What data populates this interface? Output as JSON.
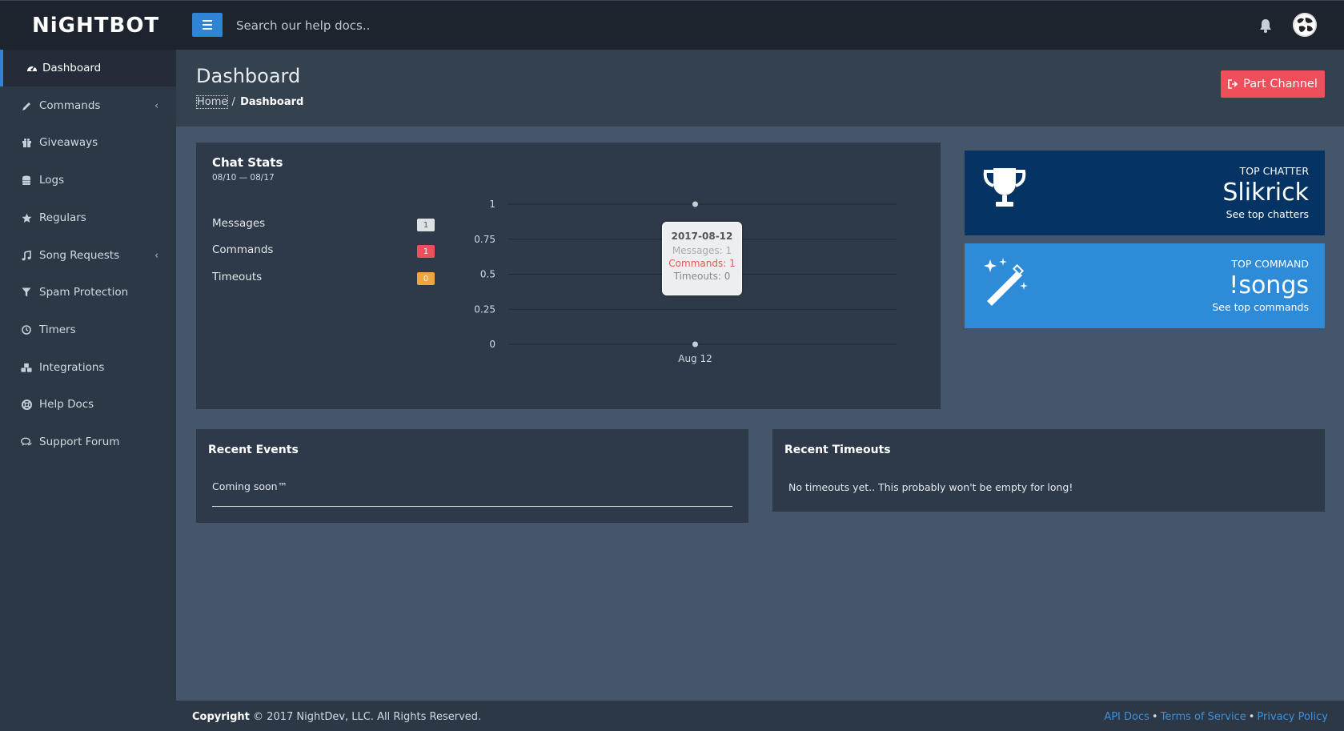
{
  "app": {
    "logo": "NiGHTBOT"
  },
  "topbar": {
    "search_placeholder": "Search our help docs.."
  },
  "sidebar": {
    "items": [
      {
        "label": "Dashboard",
        "icon": "dashboard-icon",
        "active": true
      },
      {
        "label": "Commands",
        "icon": "pencil-icon",
        "submenu": true
      },
      {
        "label": "Giveaways",
        "icon": "gift-icon"
      },
      {
        "label": "Logs",
        "icon": "database-icon"
      },
      {
        "label": "Regulars",
        "icon": "star-icon"
      },
      {
        "label": "Song Requests",
        "icon": "music-icon",
        "submenu": true
      },
      {
        "label": "Spam Protection",
        "icon": "filter-icon"
      },
      {
        "label": "Timers",
        "icon": "clock-icon"
      },
      {
        "label": "Integrations",
        "icon": "cubes-icon"
      },
      {
        "label": "Help Docs",
        "icon": "lifebuoy-icon"
      },
      {
        "label": "Support Forum",
        "icon": "comments-icon"
      }
    ]
  },
  "header": {
    "title": "Dashboard",
    "breadcrumb_home": "Home",
    "breadcrumb_sep": "/",
    "breadcrumb_current": "Dashboard",
    "part_button": "Part Channel"
  },
  "chat_stats": {
    "title": "Chat Stats",
    "range": "08/10 — 08/17",
    "rows": [
      {
        "label": "Messages",
        "value": "1",
        "color": "#dde1e5"
      },
      {
        "label": "Commands",
        "value": "1",
        "color": "#ef4f5a"
      },
      {
        "label": "Timeouts",
        "value": "0",
        "color": "#f0a43c"
      }
    ],
    "tooltip": {
      "date": "2017-08-12",
      "messages": "Messages: 1",
      "commands": "Commands: 1",
      "timeouts": "Timeouts: 0"
    }
  },
  "chart_data": {
    "type": "line",
    "x": [
      "Aug 12"
    ],
    "series": [
      {
        "name": "Messages",
        "values": [
          1
        ]
      },
      {
        "name": "Commands",
        "values": [
          1
        ]
      },
      {
        "name": "Timeouts",
        "values": [
          0
        ]
      }
    ],
    "yticks": [
      "1",
      "0.75",
      "0.5",
      "0.25",
      "0"
    ],
    "ylim": [
      0,
      1
    ],
    "grid": true
  },
  "top_chatter": {
    "label": "TOP CHATTER",
    "value": "Slikrick",
    "link": "See top chatters"
  },
  "top_command": {
    "label": "TOP COMMAND",
    "value": "!songs",
    "link": "See top commands"
  },
  "recent_events": {
    "title": "Recent Events",
    "body": "Coming soon™"
  },
  "recent_timeouts": {
    "title": "Recent Timeouts",
    "body": "No timeouts yet.. This probably won't be empty for long!"
  },
  "footer": {
    "copyright_bold": "Copyright",
    "copyright_rest": "© 2017 NightDev, LLC. All Rights Reserved.",
    "links": [
      "API Docs",
      "Terms of Service",
      "Privacy Policy"
    ],
    "separator": "•"
  }
}
